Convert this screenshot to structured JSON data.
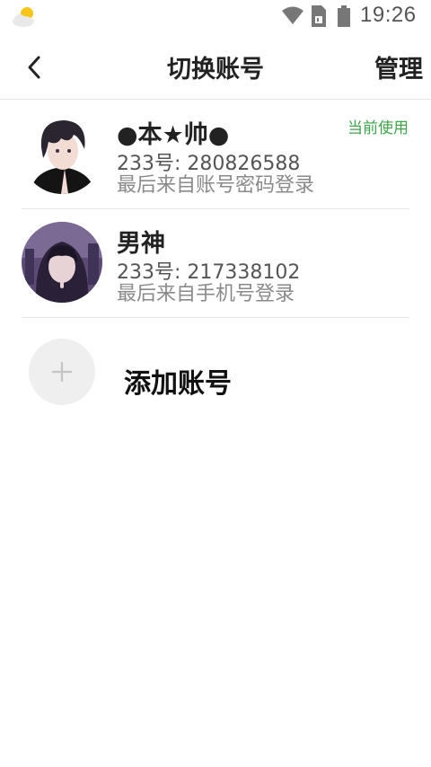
{
  "status_bar": {
    "time": "19:26",
    "icons": [
      "weather-icon",
      "wifi-icon",
      "sim-card-icon",
      "battery-icon"
    ]
  },
  "nav": {
    "back_icon": "chevron-left-icon",
    "title": "切换账号",
    "manage_label": "管理"
  },
  "accounts": [
    {
      "name": "●本★帅●",
      "id_text": "233号: 280826588",
      "login_text": "最后来自账号密码登录",
      "current_label": "当前使用",
      "avatar": "avatar-dark-haired-boy"
    },
    {
      "name": "男神",
      "id_text": "233号: 217338102",
      "login_text": "最后来自手机号登录",
      "avatar": "avatar-hooded-boy"
    }
  ],
  "add_account": {
    "label": "添加账号",
    "icon": "plus-icon"
  },
  "colors": {
    "accent_green": "#3da649",
    "divider": "#e8e8e8"
  }
}
